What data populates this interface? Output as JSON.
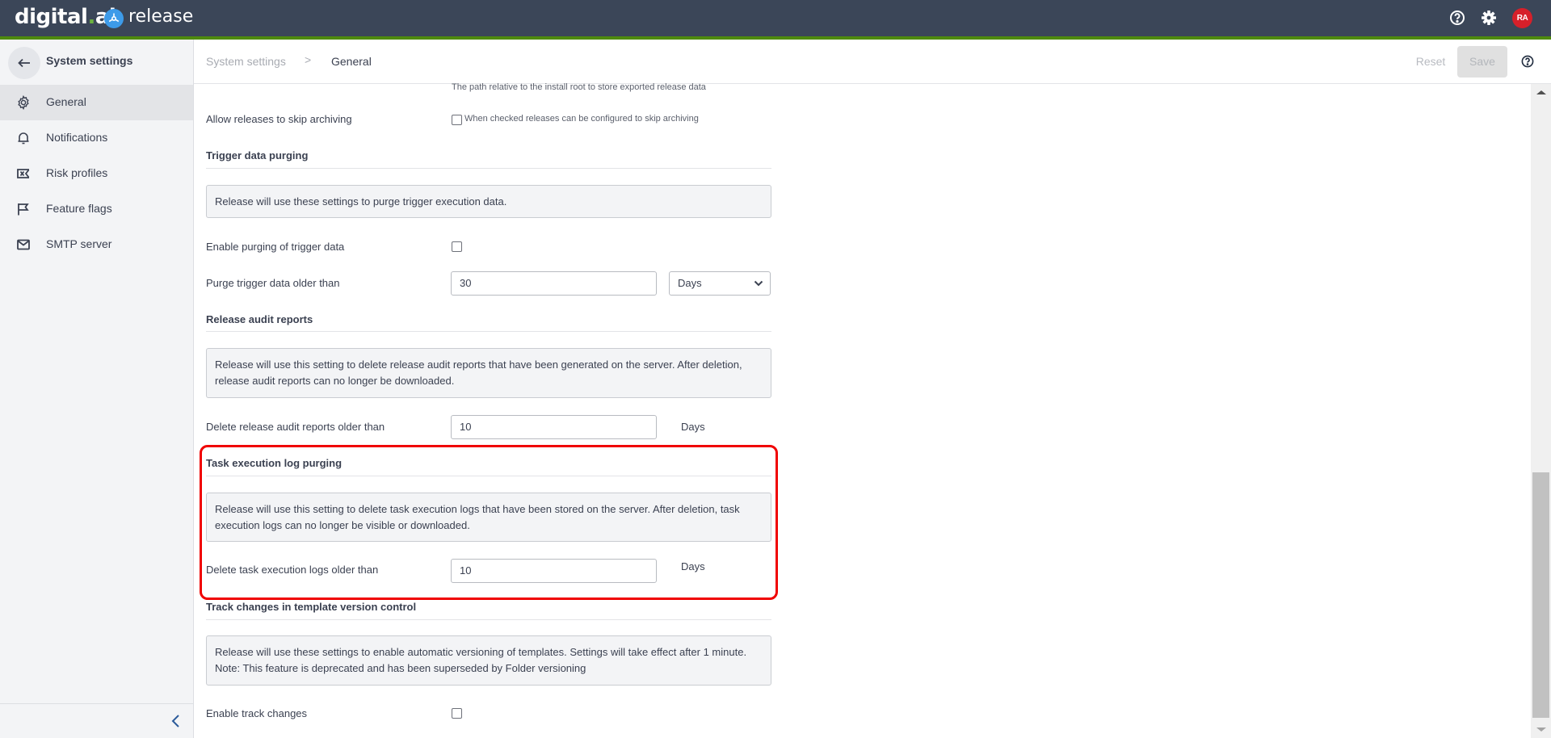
{
  "header": {
    "brand": "digital.ai",
    "product": "release",
    "icons": [
      "help-icon",
      "gear-icon"
    ],
    "avatar_initials": "RA",
    "colors": {
      "bar": "#3b4658",
      "accent_line": "#4e8a0e",
      "avatar": "#d6202a"
    }
  },
  "sidebar": {
    "title": "System settings",
    "back_icon": "arrow-left-icon",
    "items": [
      {
        "label": "General",
        "icon": "gear-icon",
        "active": true
      },
      {
        "label": "Notifications",
        "icon": "bell-icon",
        "active": false
      },
      {
        "label": "Risk profiles",
        "icon": "risk-icon",
        "active": false
      },
      {
        "label": "Feature flags",
        "icon": "flag-icon",
        "active": false
      },
      {
        "label": "SMTP server",
        "icon": "envelope-icon",
        "active": false
      }
    ],
    "collapse_icon": "chevron-left-icon"
  },
  "breadcrumb": {
    "items": [
      "System settings",
      "General"
    ],
    "separator": ">"
  },
  "toolbar": {
    "reset_label": "Reset",
    "save_label": "Save",
    "help_icon": "help-icon"
  },
  "content": {
    "export_path_hint": "The path relative to the install root to store exported release data",
    "skip_archiving": {
      "label": "Allow releases to skip archiving",
      "checked": false,
      "hint": "When checked releases can be configured to skip archiving"
    },
    "trigger_purging": {
      "heading": "Trigger data purging",
      "info": "Release will use these settings to purge trigger execution data.",
      "enable_label": "Enable purging of trigger data",
      "enable_checked": false,
      "older_label": "Purge trigger data older than",
      "older_value": "30",
      "unit_selected": "Days"
    },
    "audit_reports": {
      "heading": "Release audit reports",
      "info": "Release will use this setting to delete release audit reports that have been generated on the server. After deletion, release audit reports can no longer be downloaded.",
      "older_label": "Delete release audit reports older than",
      "older_value": "10",
      "unit": "Days"
    },
    "task_log_purging": {
      "heading": "Task execution log purging",
      "info": "Release will use this setting to delete task execution logs that have been stored on the server. After deletion, task execution logs can no longer be visible or downloaded.",
      "older_label": "Delete task execution logs older than",
      "older_value": "10",
      "unit": "Days",
      "highlight_color": "#f00000"
    },
    "track_changes": {
      "heading": "Track changes in template version control",
      "info": "Release will use these settings to enable automatic versioning of templates. Settings will take effect after 1 minute. Note: This feature is deprecated and has been superseded by Folder versioning",
      "info_line1": "Release will use these settings to enable automatic versioning of templates. Settings will take effect after 1 minute.",
      "info_line2": "Note: This feature is deprecated and has been superseded by Folder versioning",
      "enable_label": "Enable track changes",
      "enable_checked": false
    }
  }
}
